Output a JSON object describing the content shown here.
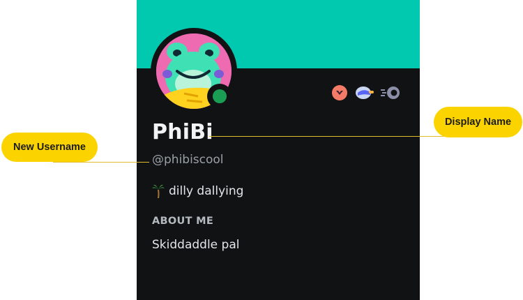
{
  "profile": {
    "display_name": "PhiBi",
    "username": "@phibiscool",
    "custom_status": {
      "emoji": "palm-tree",
      "text": "dilly dallying"
    },
    "about_title": "ABOUT ME",
    "about_body": "Skiddaddle pal",
    "online_status": "online",
    "badges": [
      "hypesquad-brilliance-badge",
      "quest-helmet-badge",
      "nitro-boost-badge"
    ]
  },
  "annotations": {
    "new_username": "New Username",
    "display_name": "Display Name"
  },
  "colors": {
    "banner": "#00c9b0",
    "card_background": "#111214",
    "status_online": "#1a9e54",
    "callout": "#fbd400",
    "avatar_background": "#ee6bb2"
  }
}
